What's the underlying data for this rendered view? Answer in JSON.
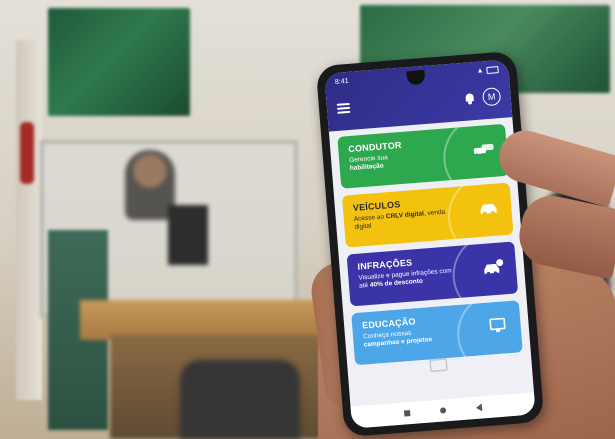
{
  "status_bar": {
    "time": "8:41"
  },
  "header": {
    "avatar_initial": "M"
  },
  "cards": [
    {
      "title": "CONDUTOR",
      "desc_line1": "Gerencie sua",
      "desc_bold": "habilitação",
      "color": "#2ea84f",
      "icon": "car-pair-icon"
    },
    {
      "title": "VEÍCULOS",
      "desc_line1": "Acesse ao",
      "desc_bold": "CRLV digital",
      "desc_line2": ", venda digital",
      "color": "#f2c20f",
      "icon": "car-icon"
    },
    {
      "title": "INFRAÇÕES",
      "desc_line1": "Visualize e pague infrações com até",
      "desc_bold": "40% de desconto",
      "color": "#3a34a8",
      "icon": "car-alert-icon"
    },
    {
      "title": "EDUCAÇÃO",
      "desc_line1": "Conheça nossas",
      "desc_bold": "campanhas e projetos",
      "color": "#4da6e8",
      "icon": "monitor-icon"
    }
  ]
}
